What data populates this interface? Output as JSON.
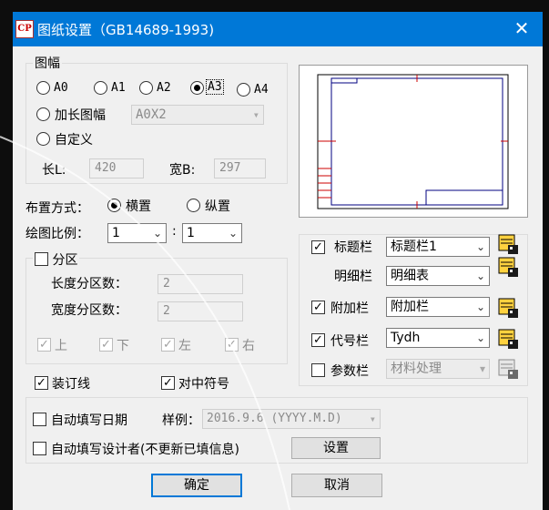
{
  "window": {
    "title": "图纸设置（GB14689-1993)",
    "app_icon_text": "CP"
  },
  "sheet": {
    "legend": "图幅",
    "sizes": [
      {
        "label": "A0",
        "selected": false
      },
      {
        "label": "A1",
        "selected": false
      },
      {
        "label": "A2",
        "selected": false
      },
      {
        "label": "A3",
        "selected": true
      },
      {
        "label": "A4",
        "selected": false
      }
    ],
    "extended_label": "加长图幅",
    "extended_value": "A0X2",
    "custom_label": "自定义",
    "length_label": "长L:",
    "length_value": "420",
    "width_label": "宽B:",
    "width_value": "297"
  },
  "layout": {
    "label": "布置方式：",
    "landscape": "横置",
    "portrait": "纵置",
    "selected": "landscape"
  },
  "scale": {
    "label": "绘图比例：",
    "left": "1",
    "sep": ":",
    "right": "1"
  },
  "zones": {
    "label": "分区",
    "checked": false,
    "length_label": "长度分区数：",
    "length_value": "2",
    "width_label": "宽度分区数：",
    "width_value": "2",
    "sides": [
      {
        "label": "上",
        "checked": true
      },
      {
        "label": "下",
        "checked": true
      },
      {
        "label": "左",
        "checked": true
      },
      {
        "label": "右",
        "checked": true
      }
    ]
  },
  "binding_label": "装订线",
  "binding_checked": true,
  "center_mark_label": "对中符号",
  "center_mark_checked": true,
  "blocks": [
    {
      "label": "标题栏",
      "checked": true,
      "has_check": true,
      "value": "标题栏1",
      "enabled": true
    },
    {
      "label": "明细栏",
      "checked": false,
      "has_check": false,
      "value": "明细表",
      "enabled": true
    },
    {
      "label": "附加栏",
      "checked": true,
      "has_check": true,
      "value": "附加栏",
      "enabled": true
    },
    {
      "label": "代号栏",
      "checked": true,
      "has_check": true,
      "value": "Tydh",
      "enabled": true
    },
    {
      "label": "参数栏",
      "checked": false,
      "has_check": true,
      "value": "材料处理",
      "enabled": false
    }
  ],
  "auto": {
    "date_label": "自动填写日期",
    "date_checked": false,
    "sample_label": "样例：",
    "sample_value": "2016.9.6 (YYYY.M.D)",
    "designer_label": "自动填写设计者(不更新已填信息)",
    "designer_checked": false,
    "settings_label": "设置"
  },
  "ok_label": "确定",
  "cancel_label": "取消",
  "close_glyph": "✕",
  "check_glyph": "✓",
  "colors": {
    "titlebar": "#0078d7",
    "preview_frame": "#000080",
    "preview_marks": "#cc0000",
    "dialog_bg": "#f0f0f0"
  }
}
